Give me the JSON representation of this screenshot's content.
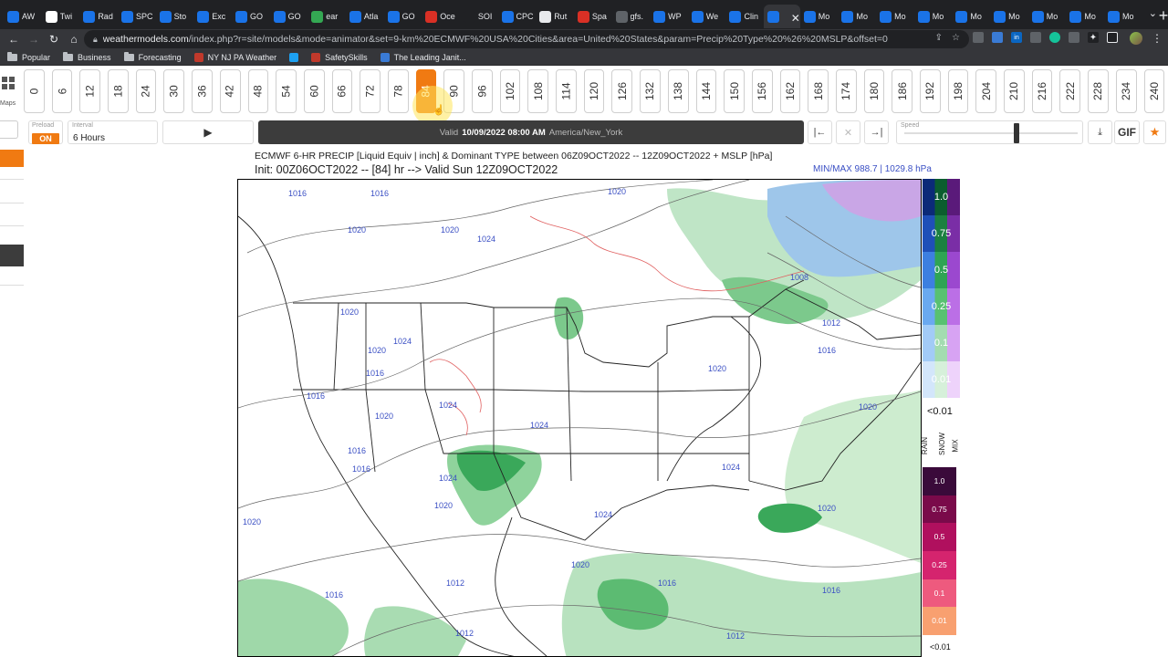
{
  "browser": {
    "tabs": [
      {
        "title": "AW",
        "color": "#1a73e8"
      },
      {
        "title": "Twi",
        "color": "#ffffff"
      },
      {
        "title": "Rad",
        "color": "#1a73e8"
      },
      {
        "title": "SPC",
        "color": "#1a73e8"
      },
      {
        "title": "Sto",
        "color": "#1a73e8"
      },
      {
        "title": "Exc",
        "color": "#1a73e8"
      },
      {
        "title": "GO",
        "color": "#1a73e8"
      },
      {
        "title": "GO",
        "color": "#1a73e8"
      },
      {
        "title": "ear",
        "color": "#34a853"
      },
      {
        "title": "Atla",
        "color": "#1a73e8"
      },
      {
        "title": "GO",
        "color": "#1a73e8"
      },
      {
        "title": "Oce",
        "color": "#d93025"
      },
      {
        "title": "SOI",
        "color": "#202124"
      },
      {
        "title": "CPC",
        "color": "#1a73e8"
      },
      {
        "title": "Rut",
        "color": "#e8eaed"
      },
      {
        "title": "Spa",
        "color": "#d93025"
      },
      {
        "title": "gfs.",
        "color": "#5f6368"
      },
      {
        "title": "WP",
        "color": "#1a73e8"
      },
      {
        "title": "We",
        "color": "#1a73e8"
      },
      {
        "title": "Clin",
        "color": "#1a73e8"
      }
    ],
    "active_tab": {
      "title": "",
      "color": "#1a73e8"
    },
    "tabs_after": [
      {
        "title": "Mo",
        "color": "#1a73e8"
      },
      {
        "title": "Mo",
        "color": "#1a73e8"
      },
      {
        "title": "Mo",
        "color": "#1a73e8"
      },
      {
        "title": "Mo",
        "color": "#1a73e8"
      },
      {
        "title": "Mo",
        "color": "#1a73e8"
      },
      {
        "title": "Mo",
        "color": "#1a73e8"
      },
      {
        "title": "Mo",
        "color": "#1a73e8"
      },
      {
        "title": "Mo",
        "color": "#1a73e8"
      },
      {
        "title": "Mo",
        "color": "#1a73e8"
      }
    ],
    "close_glyph": "✕",
    "newtab_glyph": "+",
    "menu_glyph": "⌄",
    "url_host": "weathermodels.com",
    "url_path": "/index.php?r=site/models&mode=animator&set=9-km%20ECMWF%20USA%20Cities&area=United%20States&param=Precip%20Type%20%26%20MSLP&offset=0",
    "bookmarks": [
      {
        "label": "Popular",
        "kind": "folder"
      },
      {
        "label": "Business",
        "kind": "folder"
      },
      {
        "label": "Forecasting",
        "kind": "folder"
      },
      {
        "label": "NY NJ PA Weather",
        "kind": "fav",
        "color": "#c0392b"
      },
      {
        "label": "",
        "kind": "fav",
        "color": "#1da1f2"
      },
      {
        "label": "SafetySkills",
        "kind": "fav",
        "color": "#c0392b"
      },
      {
        "label": "The Leading Janit...",
        "kind": "fav",
        "color": "#3a7bd5"
      }
    ]
  },
  "animator": {
    "maps_label": "Maps",
    "hours": [
      "0",
      "6",
      "12",
      "18",
      "24",
      "30",
      "36",
      "42",
      "48",
      "54",
      "60",
      "66",
      "72",
      "78",
      "84",
      "90",
      "96",
      "102",
      "108",
      "114",
      "120",
      "126",
      "132",
      "138",
      "144",
      "150",
      "156",
      "162",
      "168",
      "174",
      "180",
      "186",
      "192",
      "198",
      "204",
      "210",
      "216",
      "222",
      "228",
      "234",
      "240"
    ],
    "selected_hour": "84",
    "preload_label": "Preload",
    "preload_value": "ON",
    "interval_label": "Interval",
    "interval_value": "6 Hours",
    "play_glyph": "▶",
    "valid_label": "Valid",
    "valid_time": "10/09/2022 08:00 AM",
    "valid_tz": "America/New_York",
    "first_glyph": "|←",
    "stop_glyph": "✕",
    "last_glyph": "→|",
    "speed_label": "Speed",
    "speed_level": 0.63,
    "download_glyph": "⤓",
    "gif_label": "GIF",
    "star_glyph": "★"
  },
  "map": {
    "title": "ECMWF 6-HR PRECIP [Liquid Equiv | inch] & Dominant TYPE between 06Z09OCT2022 -- 12Z09OCT2022 + MSLP [hPa]",
    "subtitle": "Init: 00Z06OCT2022 -- [84] hr --> Valid Sun 12Z09OCT2022",
    "minmax": "MIN/MAX 988.7 | 1029.8 hPa",
    "isobar_labels": [
      "1016",
      "1016",
      "1020",
      "1020",
      "1020",
      "1024",
      "1024",
      "1020",
      "1016",
      "1020",
      "1016",
      "1020",
      "1024",
      "1024",
      "1024",
      "1020",
      "1016",
      "1016",
      "1020",
      "1020",
      "1012",
      "1016",
      "1024",
      "1024",
      "1012",
      "1020",
      "1016",
      "1012",
      "1016",
      "1008",
      "1012",
      "1016",
      "1020",
      "1020"
    ],
    "colors": {
      "rain_light": "#cfead2",
      "rain": "#79c98a",
      "rain_heavy": "#2e9c4d",
      "snow": "#7fb3de",
      "mix": "#c9a6e6",
      "isobar": "#555555",
      "isobar_label": "#3a4fc4",
      "temp_line": "#e06060"
    }
  },
  "colorbar": {
    "rain_values": [
      "1.0",
      "0.75",
      "0.5",
      "0.25",
      "0.1",
      "0.01"
    ],
    "rain_colors": [
      "#0b5d2e",
      "#1b8040",
      "#2fa453",
      "#58c171",
      "#a3dcb0",
      "#d6f0da"
    ],
    "snow_colors": [
      "#0b2a78",
      "#1f4fb8",
      "#3d7fe0",
      "#6aa9f0",
      "#a2cbf7",
      "#d3e6fb"
    ],
    "mix_colors": [
      "#5a1a7a",
      "#7a2ea6",
      "#9b48cf",
      "#bb6fe6",
      "#d7a3f3",
      "#eed3fb"
    ],
    "lt_label": "<0.01",
    "type_labels": [
      "RAIN",
      "SNOW",
      "MIX"
    ],
    "ice_values": [
      "1.0",
      "0.75",
      "0.5",
      "0.25",
      "0.1",
      "0.01"
    ],
    "ice_colors": [
      "#3a0a3a",
      "#7a0a4a",
      "#b0105e",
      "#d5246e",
      "#ee5a7e",
      "#f8a070"
    ],
    "lt_label2": "<0.01"
  }
}
